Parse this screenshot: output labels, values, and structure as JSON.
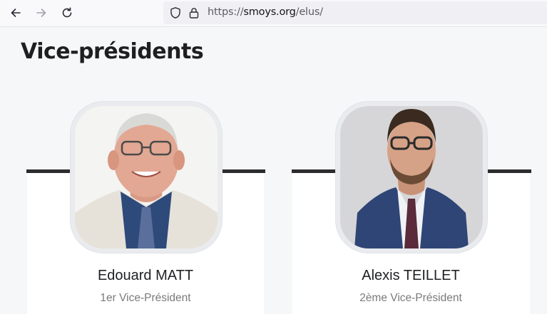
{
  "browser": {
    "url_scheme": "https://",
    "url_host": "smoys.org",
    "url_path": "/elus/",
    "icons": [
      "back-arrow-icon",
      "forward-arrow-icon",
      "reload-icon",
      "shield-icon",
      "lock-icon"
    ]
  },
  "page": {
    "title": "Vice-présidents"
  },
  "people": [
    {
      "name": "Edouard MATT",
      "role": "1er Vice-Président"
    },
    {
      "name": "Alexis TEILLET",
      "role": "2ème Vice-Président"
    }
  ],
  "colors": {
    "accent_bar": "#2c2c2e",
    "page_background": "#f6f7f9"
  }
}
